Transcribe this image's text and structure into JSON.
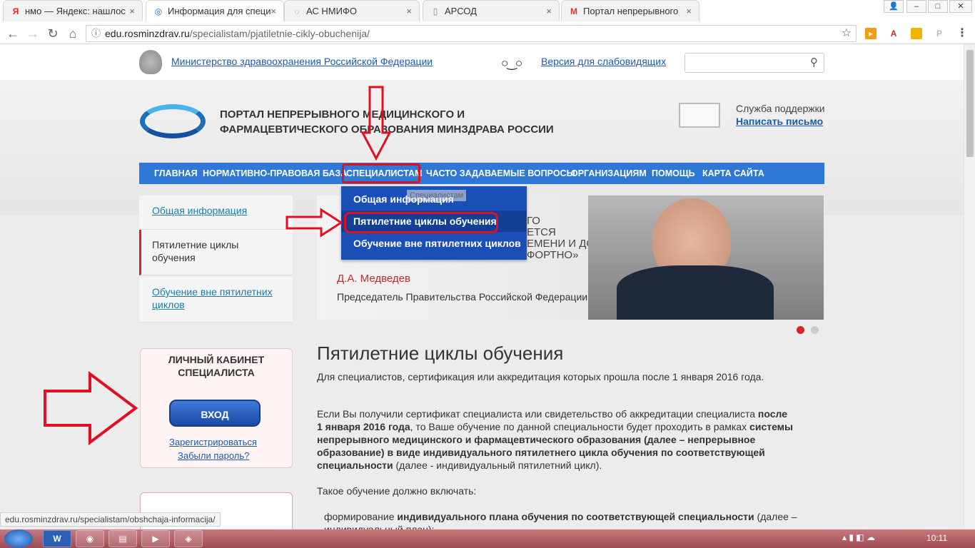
{
  "browser": {
    "tabs": [
      {
        "favicon": "Я",
        "title": "нмо — Яндекс: нашлос"
      },
      {
        "favicon": "◎",
        "title": "Информация для специ"
      },
      {
        "favicon": "◌",
        "title": "АС НМИФО"
      },
      {
        "favicon": "▯",
        "title": "АРСОД"
      },
      {
        "favicon": "M",
        "title": "Портал непрерывного"
      }
    ],
    "close_glyph": "×",
    "url_host": "edu.rosminzdrav.ru",
    "url_path": "/specialistam/pjatiletnie-cikly-obuchenija/",
    "status_url": "edu.rosminzdrav.ru/specialistam/obshchaja-informacija/"
  },
  "page": {
    "ministry_link": "Министерство здравоохранения Российской Федерации",
    "low_vision_link": "Версия для слабовидящих",
    "search_placeholder": "",
    "portal_title_1": "ПОРТАЛ НЕПРЕРЫВНОГО МЕДИЦИНСКОГО И",
    "portal_title_2": "ФАРМАЦЕВТИЧЕСКОГО ОБРАЗОВАНИЯ МИНЗДРАВА РОССИИ",
    "support_label": "Служба поддержки",
    "support_link": "Написать письмо",
    "nav": [
      "Главная",
      "Нормативно-правовая база",
      "Специалистам",
      "Часто задаваемые вопросы",
      "Организациям",
      "Помощь",
      "Карта сайта"
    ],
    "dropdown": [
      "Общая информация",
      "Пятилетние циклы обучения",
      "Обучение вне пятилетних циклов"
    ],
    "tooltip": "Специалистам",
    "sidebar": [
      "Общая информация",
      "Пятилетние циклы обучения",
      "Обучение вне пятилетних циклов"
    ],
    "cabinet_title": "ЛИЧНЫЙ КАБИНЕТ СПЕЦИАЛИСТА",
    "login_button": "ВХОД",
    "register_link": "Зарегистрироваться",
    "forgot_link": "Забыли пароль?",
    "banner_quote_1": "ГО",
    "banner_quote_2": "ЕТСЯ",
    "banner_quote_3": "ЕМЕНИ И ДОЛЖНО",
    "banner_quote_4": "ФОРТНО»",
    "banner_author": "Д.А. Медведев",
    "banner_role": "Председатель Правительства Российской Федерации",
    "heading": "Пятилетние циклы обучения",
    "intro": "Для специалистов, сертификация или аккредитация которых прошла после 1 января 2016 года.",
    "para1_a": "Если Вы получили сертификат специалиста или свидетельство об аккредитации специалиста ",
    "para1_b": "после 1 января 2016 года",
    "para1_c": ", то Ваше обучение по данной специальности будет проходить в рамках ",
    "para1_d": "системы непрерывного медицинского и фармацевтического образования (далее – непрерывное образование) в виде индивидуального пятилетнего цикла обучения по соответствующей специальности",
    "para1_e": " (далее - индивидуальный пятилетний цикл).",
    "para2": "Такое обучение должно включать:",
    "bullet1_a": "формирование ",
    "bullet1_b": "индивидуального плана обучения по соответствующей специальности",
    "bullet1_c": " (далее –",
    "bullet1_d": "индивидуальный план);"
  },
  "taskbar": {
    "clock": "10:11",
    "apps": [
      "W",
      "◉",
      "▤",
      "▶",
      "◈"
    ]
  },
  "colors": {
    "nav_blue": "#2f78d8",
    "dropdown_blue": "#1b4fb8",
    "annotation_red": "#e01020"
  }
}
